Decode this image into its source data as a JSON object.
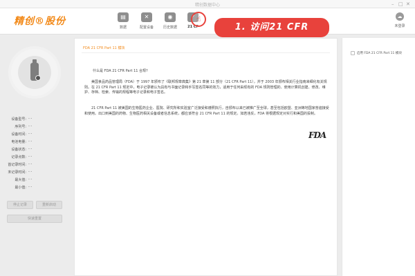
{
  "window": {
    "title": "精创数据中心"
  },
  "brand": {
    "logo_text": "精创®股份",
    "accent_color": "#f28a1a"
  },
  "toolbar": {
    "items": [
      {
        "label": "数据",
        "icon": "document-icon"
      },
      {
        "label": "配置设备",
        "icon": "tools-icon"
      },
      {
        "label": "历史数据",
        "icon": "history-icon"
      },
      {
        "label": "21 CF",
        "icon": "cfr-icon"
      }
    ],
    "unlogged_label": "未登录"
  },
  "annotation": {
    "text": "1. 访问21 CFR",
    "color": "#e8423c"
  },
  "device_info": {
    "rows": [
      {
        "label": "设备型号:",
        "value": "- -"
      },
      {
        "label": "序列号:",
        "value": "- -"
      },
      {
        "label": "设备时间:",
        "value": "- -"
      },
      {
        "label": "电池电量:",
        "value": "- -"
      },
      {
        "label": "设备状态:",
        "value": "- -"
      },
      {
        "label": "记录点数:",
        "value": "- -"
      },
      {
        "label": "首记录时间:",
        "value": "- -"
      },
      {
        "label": "末记录时间:",
        "value": "- -"
      },
      {
        "label": "最大值:",
        "value": "- -"
      },
      {
        "label": "最小值:",
        "value": "- -"
      }
    ],
    "buttons": {
      "stop": "停止记录",
      "restart": "重新启动",
      "quick_reset": "快速重置"
    }
  },
  "content": {
    "tab_label": "FDA 21 CFR Part 11 模块",
    "question": "什么是 FDA 21 CFR Part 11 合规?",
    "paragraph1": "美国食品药品管理局（FDA）于 1997 年颁布了《联邦规章典集》第 21 章第 11 部分（21 CFR Part 11），并于 2003 年颁布相关行业指南来细化有关规则。在 21 CFR Part 11 规定中，电子记录被认为具有与书面记录和手写签名同等的效力，适用于任何由现有的 FDA 规则管理的、使用计算机创建、修改、维护、存档、检索、传输的规程等电子记录和电子签名。",
    "paragraph2": "21 CFR Part 11 被美国的生物医药企业、医院、研究所和实验室广泛接受和遵照执行，自颁布以来已被推广至全球，甚至包括欧盟、亚洲等地国家普遍接受和使用。出口到美国的药物、生物医药相关设备或者信息系统，都应该符合 21 CFR Part 11 的规定。如若违反，FDA 将根据规定对实行和美国的投制。",
    "fda_logo_text": "FDA"
  },
  "right_panel": {
    "checkbox_label": "启用 FDA 21 CFR Part 11 模块",
    "checked": false
  }
}
